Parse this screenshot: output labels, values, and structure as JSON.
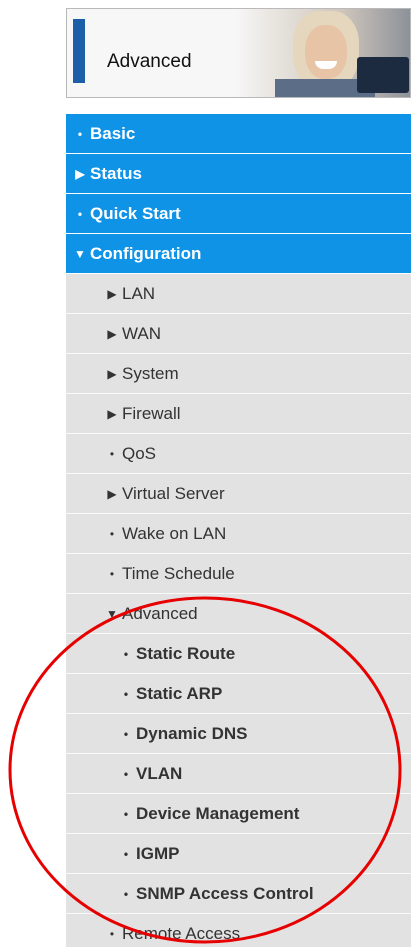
{
  "header": {
    "title": "Advanced"
  },
  "menu": {
    "top_items": [
      {
        "label": "Basic",
        "icon": "bullet"
      },
      {
        "label": "Status",
        "icon": "triangle-right"
      },
      {
        "label": "Quick Start",
        "icon": "bullet"
      },
      {
        "label": "Configuration",
        "icon": "triangle-down"
      }
    ],
    "config_items": [
      {
        "label": "LAN",
        "icon": "triangle-right"
      },
      {
        "label": "WAN",
        "icon": "triangle-right"
      },
      {
        "label": "System",
        "icon": "triangle-right"
      },
      {
        "label": "Firewall",
        "icon": "triangle-right"
      },
      {
        "label": "QoS",
        "icon": "bullet"
      },
      {
        "label": "Virtual Server",
        "icon": "triangle-right"
      },
      {
        "label": "Wake on LAN",
        "icon": "bullet"
      },
      {
        "label": "Time Schedule",
        "icon": "bullet"
      },
      {
        "label": "Advanced",
        "icon": "triangle-down"
      }
    ],
    "advanced_items": [
      {
        "label": "Static Route",
        "icon": "bullet"
      },
      {
        "label": "Static ARP",
        "icon": "bullet"
      },
      {
        "label": "Dynamic DNS",
        "icon": "bullet"
      },
      {
        "label": "VLAN",
        "icon": "bullet"
      },
      {
        "label": "Device Management",
        "icon": "bullet"
      },
      {
        "label": "IGMP",
        "icon": "bullet"
      },
      {
        "label": "SNMP Access Control",
        "icon": "bullet"
      }
    ],
    "last_items": [
      {
        "label": "Remote Access",
        "icon": "bullet"
      }
    ]
  },
  "colors": {
    "top_bar": "#0f93e7",
    "sub_bar": "#e2e2e2",
    "annotation": "#e60000"
  },
  "icons": {
    "bullet": "bullet-icon",
    "triangle-right": "triangle-right-icon",
    "triangle-down": "triangle-down-icon"
  }
}
